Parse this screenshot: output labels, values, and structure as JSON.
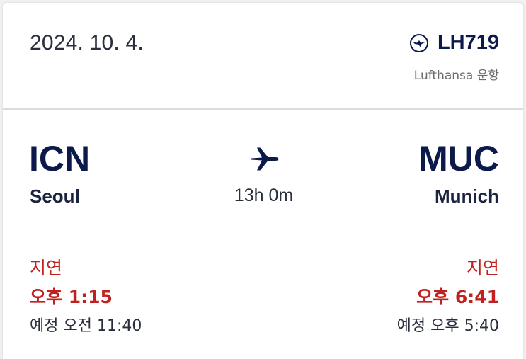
{
  "header": {
    "date": "2024. 10. 4.",
    "flight_number": "LH719",
    "operator": "Lufthansa 운항",
    "logo_icon": "lufthansa-crane-icon"
  },
  "route": {
    "plane_icon": "airplane-icon",
    "duration": "13h 0m",
    "origin": {
      "code": "ICN",
      "city": "Seoul",
      "status": "지연",
      "actual_time": "오후 1:15",
      "scheduled_time": "예정 오전 11:40"
    },
    "destination": {
      "code": "MUC",
      "city": "Munich",
      "status": "지연",
      "actual_time": "오후 6:41",
      "scheduled_time": "예정 오후 5:40"
    }
  },
  "colors": {
    "navy": "#0b1a4a",
    "delay_red": "#c0201e",
    "text_dark": "#2a2f3d",
    "text_muted": "#6b6b6b"
  }
}
